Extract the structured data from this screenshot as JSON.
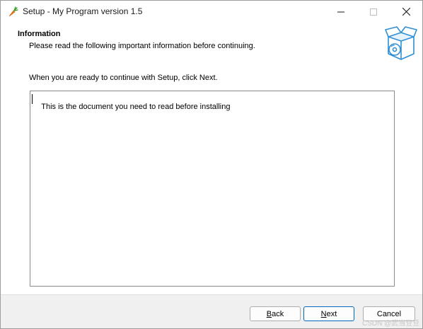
{
  "window": {
    "title": "Setup - My Program version 1.5",
    "app_icon": "carrot-icon",
    "controls": [
      "minimize-icon",
      "maximize-icon",
      "close-icon"
    ]
  },
  "header": {
    "title": "Information",
    "subtitle": "Please read the following important information before continuing.",
    "icon": "setup-box-disc-icon"
  },
  "body": {
    "intro": "When you are ready to continue with Setup, click Next.",
    "memo_text": "This is the document you need to read before installing"
  },
  "footer": {
    "back_label": "Back",
    "back_mnemonic": "B",
    "back_rest": "ack",
    "next_label": "Next",
    "next_mnemonic": "N",
    "next_rest": "ext",
    "cancel_label": "Cancel"
  },
  "watermark": "CSDN @武当豆豆",
  "colors": {
    "accent": "#0067c0",
    "footer_bg": "#f0f0f0",
    "icon_blue": "#2f8fd6",
    "carrot_orange": "#f07a1a"
  }
}
